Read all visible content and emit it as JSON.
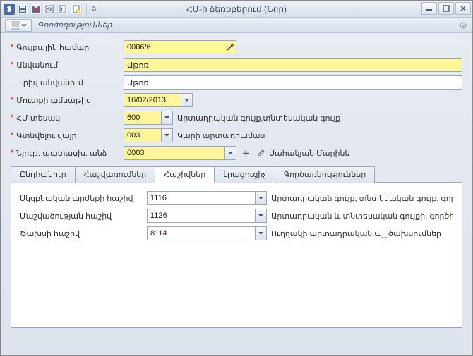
{
  "window": {
    "title": "ՀՄ-ի ձեռքբերում (Նոր)"
  },
  "menu": {
    "actions": "Գործողություններ"
  },
  "form": {
    "inventory_no_label": "Գույքային համար",
    "inventory_no": "0006/6",
    "name_label": "Անվանում",
    "name": "Աթոռ",
    "full_name_label": "Լրիվ անվանում",
    "full_name": "Աթոռ",
    "entry_date_label": "Մուտքի ամսաթիվ",
    "entry_date": "16/02/2013",
    "fa_type_label": "ՀՄ տեսակ",
    "fa_type": "600",
    "fa_type_desc": "Արտադրական գույք,տնտեսական գույք",
    "location_label": "Գտնվելու վայր",
    "location": "003",
    "location_desc": "Կարի արտադրամաս",
    "responsible_label": "Նյութ. պատասխ. անձ",
    "responsible": "0003",
    "responsible_desc": "Սահակյան Մարինե"
  },
  "tabs": {
    "general": "Ընդհանուր",
    "accruals": "Հաշվառումներ",
    "accounts": "Հաշիվներ",
    "additional": "Լրացուցիչ",
    "operations": "Գործառնություններ"
  },
  "accounts_tab": {
    "initial_value_label": "Սկզբնական արժեքի հաշիվ",
    "initial_value_code": "1116",
    "initial_value_desc": "Արտադրական գույք, տնտեսական գույք, գործիք",
    "depreciation_label": "Մաշվածության հաշիվ",
    "depreciation_code": "1126",
    "depreciation_desc": "Արտադրական և տնտեսական գույքի, գործիքներ",
    "expense_label": "Ծախսի հաշիվ",
    "expense_code": "8114",
    "expense_desc": "Ուղղակի արտադրական այլ ծախսումներ"
  }
}
